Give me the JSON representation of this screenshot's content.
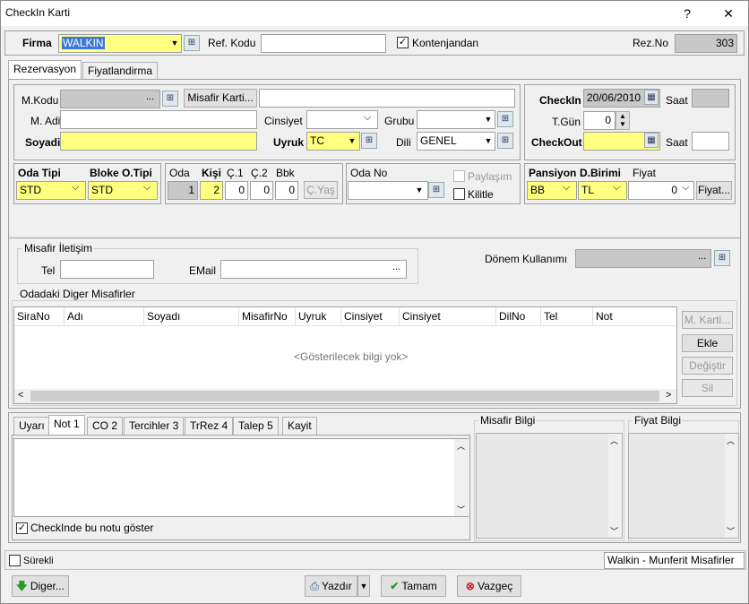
{
  "window": {
    "title": "CheckIn Karti",
    "help": "?",
    "close": "✕"
  },
  "top": {
    "firma_label": "Firma",
    "firma_value": "WALKIN",
    "ref_label": "Ref. Kodu",
    "ref_value": "",
    "kontenjan_label": "Kontenjandan",
    "kontenjan_checked": "✓",
    "rezno_label": "Rez.No",
    "rezno_value": "303"
  },
  "tabs": [
    "Rezervasyon",
    "Fiyatlandirma"
  ],
  "guest": {
    "mkodu_label": "M.Kodu",
    "mkodu_btn": "...",
    "misafir_karti": "Misafir Karti...",
    "madi_label": "M. Adi",
    "soyadi_label": "Soyadi",
    "cinsiyet_label": "Cinsiyet",
    "grubu_label": "Grubu",
    "uyruk_label": "Uyruk",
    "uyruk_value": "TC",
    "dili_label": "Dili",
    "dili_value": "GENEL"
  },
  "dates": {
    "checkin_label": "CheckIn",
    "checkin_value": "20/06/2010",
    "saat_label": "Saat",
    "tgun_label": "T.Gün",
    "tgun_value": "0",
    "checkout_label": "CheckOut",
    "saat2_label": "Saat"
  },
  "room": {
    "oda_tipi_label": "Oda Tipi",
    "oda_tipi_value": "STD",
    "bloke_label": "Bloke O.Tipi",
    "bloke_value": "STD"
  },
  "counts": {
    "oda_label": "Oda",
    "kisi_label": "Kişi",
    "c1_label": "Ç.1",
    "c2_label": "Ç.2",
    "bbk_label": "Bbk",
    "oda": "1",
    "kisi": "2",
    "c1": "0",
    "c2": "0",
    "bbk": "0",
    "cyas": "Ç.Yaş"
  },
  "odano": {
    "label": "Oda No",
    "paylasim": "Paylaşım",
    "kilitle": "Kilitle"
  },
  "pension": {
    "pansiyon_label": "Pansiyon",
    "pansiyon_value": "BB",
    "dbirimi_label": "D.Birimi",
    "dbirimi_value": "TL",
    "fiyat_label": "Fiyat",
    "fiyat_value": "0",
    "fiyat_btn": "Fiyat..."
  },
  "contact": {
    "group": "Misafir İletişim",
    "tel_label": "Tel",
    "email_label": "EMail",
    "donem_label": "Dönem Kullanımı"
  },
  "others": {
    "group": "Odadaki Diger Misafirler",
    "columns": [
      "SiraNo",
      "Adı",
      "Soyadı",
      "MisafirNo",
      "Uyruk",
      "Cinsiyet",
      "Cinsiyet",
      "DilNo",
      "Tel",
      "Not"
    ],
    "empty": "<Gösterilecek bilgi yok>",
    "buttons": [
      "M. Karti...",
      "Ekle",
      "Değiştir",
      "Sil"
    ]
  },
  "bottom_tabs": [
    "Uyarı",
    "Not 1",
    "CO 2",
    "Tercihler 3",
    "TrRez 4",
    "Talep 5",
    "Kayit"
  ],
  "note_checkbox": "CheckInde bu notu göster",
  "misafir_bilgi": "Misafir Bilgi",
  "fiyat_bilgi": "Fiyat Bilgi",
  "status": {
    "surekli": "Sürekli",
    "type": "Walkin - Munferit Misafirler"
  },
  "footer": {
    "diger": "Diger...",
    "yazdir": "Yazdır",
    "tamam": "Tamam",
    "vazgec": "Vazgeç"
  }
}
